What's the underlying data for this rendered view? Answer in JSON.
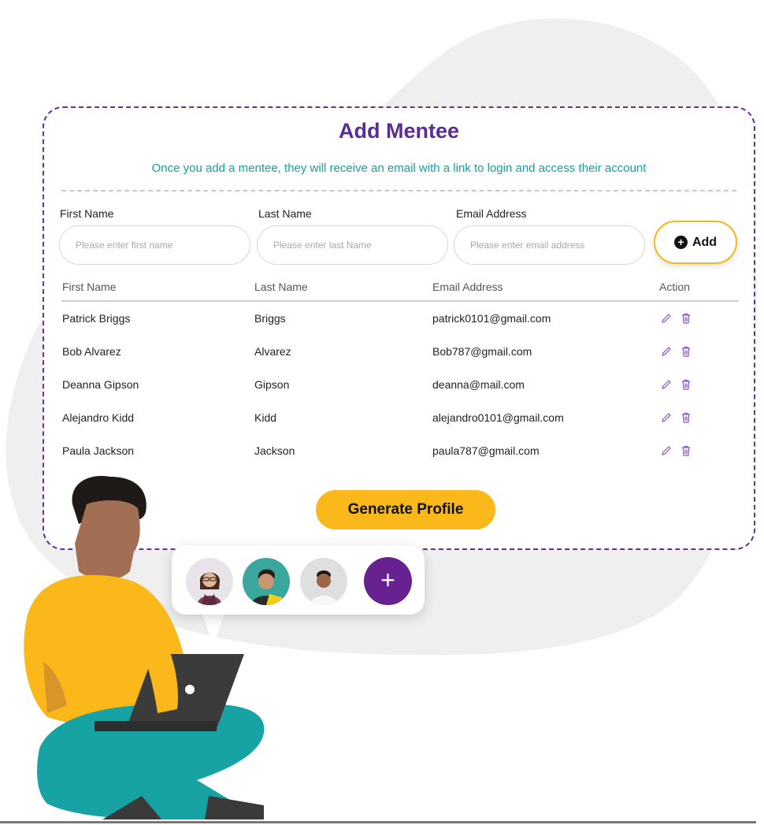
{
  "form": {
    "title": "Add Mentee",
    "subtitle": "Once you add a mentee, they will receive an email with a link to login and access their account",
    "first_name_label": "First Name",
    "last_name_label": "Last Name",
    "email_label": "Email Address",
    "first_name_placeholder": "Please enter first name",
    "last_name_placeholder": "Please enter last Name",
    "email_placeholder": "Please enter email address",
    "add_label": "Add"
  },
  "table": {
    "headers": [
      "First Name",
      "Last Name",
      "Email Address",
      "Action"
    ],
    "rows": [
      {
        "first": "Patrick Briggs",
        "last": "Briggs",
        "email": "patrick0101@gmail.com"
      },
      {
        "first": "Bob Alvarez",
        "last": "Alvarez",
        "email": "Bob787@gmail.com"
      },
      {
        "first": "Deanna Gipson",
        "last": "Gipson",
        "email": "deanna@mail.com"
      },
      {
        "first": "Alejandro Kidd",
        "last": "Kidd",
        "email": "alejandro0101@gmail.com"
      },
      {
        "first": "Paula Jackson",
        "last": "Jackson",
        "email": "paula787@gmail.com"
      }
    ]
  },
  "generate_label": "Generate Profile",
  "bubble": {
    "plus_label": "+"
  },
  "colors": {
    "accent_purple": "#5c2d91",
    "teal": "#1b9c9c",
    "yellow": "#fbb81a",
    "action_icon": "#8a55c0"
  },
  "icons": {
    "edit": "pencil-icon",
    "delete": "trash-icon",
    "add": "plus-circle-icon"
  }
}
